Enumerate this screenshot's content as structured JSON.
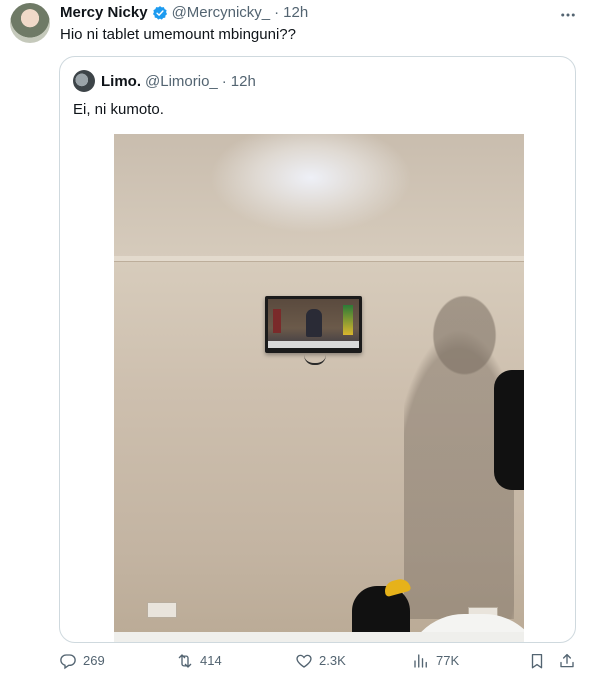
{
  "tweet": {
    "name": "Mercy Nicky",
    "handle": "@Mercynicky_",
    "separator": "·",
    "time": "12h",
    "more_icon": "more-horizontal-icon",
    "text": "Hio ni tablet umemount mbinguni??"
  },
  "quote": {
    "name": "Limo.",
    "handle": "@Limorio_",
    "separator": "·",
    "time": "12h",
    "text": "Ei, ni kumoto."
  },
  "actions": {
    "replies": "269",
    "retweets": "414",
    "likes": "2.3K",
    "views": "77K"
  },
  "colors": {
    "verified": "#1d9bf0",
    "muted": "#536471",
    "border": "#cfd9de"
  }
}
